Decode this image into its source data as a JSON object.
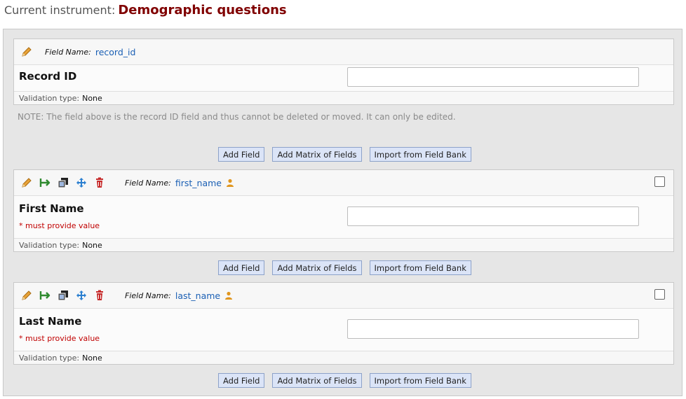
{
  "header": {
    "label": "Current instrument:",
    "instrument": "Demographic questions"
  },
  "fields": [
    {
      "field_name_label": "Field Name:",
      "field_name": "record_id",
      "label": "Record ID",
      "required": "",
      "validation_label": "Validation type:",
      "validation": "None"
    },
    {
      "field_name_label": "Field Name:",
      "field_name": "first_name",
      "label": "First Name",
      "required": "* must provide value",
      "validation_label": "Validation type:",
      "validation": "None"
    },
    {
      "field_name_label": "Field Name:",
      "field_name": "last_name",
      "label": "Last Name",
      "required": "* must provide value",
      "validation_label": "Validation type:",
      "validation": "None"
    }
  ],
  "note": "NOTE: The field above is the record ID field and thus cannot be deleted or moved. It can only be edited.",
  "buttons": {
    "add_field": "Add Field",
    "add_matrix": "Add Matrix of Fields",
    "import_bank": "Import from Field Bank"
  },
  "icons": {
    "edit": "pencil-icon",
    "branch": "branching-logic-icon",
    "copy": "copy-icon",
    "move": "move-icon",
    "delete": "trash-icon",
    "identifier": "person-icon"
  },
  "colors": {
    "instrument_title": "#800000",
    "field_name": "#1a5fb4",
    "required": "#c00000",
    "button_bg": "#dbe4f7"
  }
}
